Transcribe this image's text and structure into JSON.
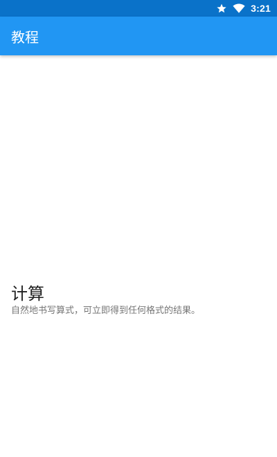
{
  "status_bar": {
    "time": "3:21",
    "icons": [
      "star-icon",
      "wifi-icon"
    ]
  },
  "app_bar": {
    "title": "教程"
  },
  "tutorial": {
    "title": "计算",
    "description": "自然地书写算式，可立即得到任何格式的结果。"
  },
  "colors": {
    "status_bar": "#0a72c9",
    "app_bar": "#2196f3",
    "background": "#ffffff",
    "title_text": "#212121",
    "description_text": "#757575"
  }
}
